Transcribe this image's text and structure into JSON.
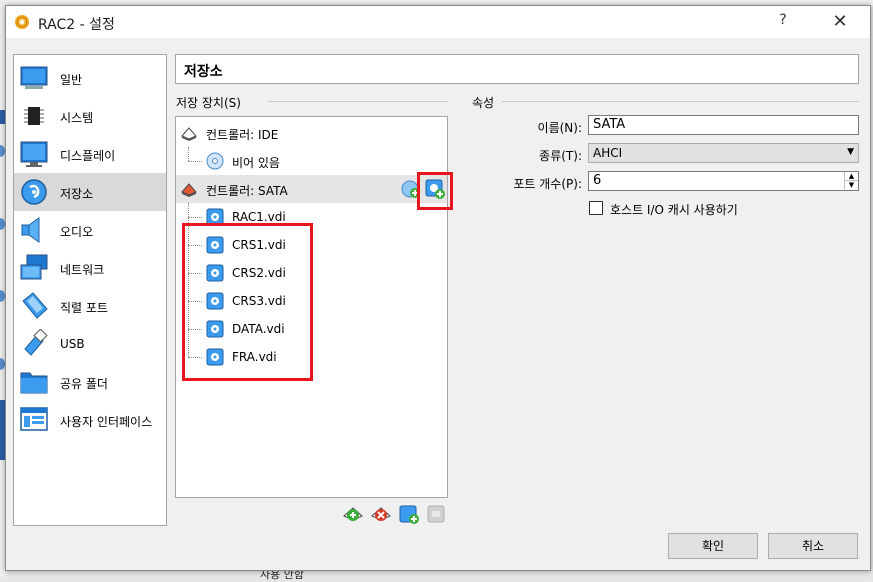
{
  "background": {
    "bottom_text": "사용 안함"
  },
  "window": {
    "title": "RAC2 - 설정",
    "help_label": "?",
    "close_label": "✕"
  },
  "nav": {
    "items": [
      {
        "label": "일반",
        "icon": "general-icon"
      },
      {
        "label": "시스템",
        "icon": "system-chip-icon"
      },
      {
        "label": "디스플레이",
        "icon": "display-icon"
      },
      {
        "label": "저장소",
        "icon": "storage-disk-icon"
      },
      {
        "label": "오디오",
        "icon": "audio-speaker-icon"
      },
      {
        "label": "네트워크",
        "icon": "network-icon"
      },
      {
        "label": "직렬 포트",
        "icon": "serial-port-icon"
      },
      {
        "label": "USB",
        "icon": "usb-icon"
      },
      {
        "label": "공유 폴더",
        "icon": "shared-folder-icon"
      },
      {
        "label": "사용자 인터페이스",
        "icon": "user-interface-icon"
      }
    ],
    "selected_index": 3
  },
  "page_title": "저장소",
  "storage": {
    "group_label": "저장 장치(S)",
    "tree": {
      "controller_ide": "컨트롤러: IDE",
      "ide_child": "비어 있음",
      "controller_sata": "컨트롤러: SATA",
      "sata_children": [
        "RAC1.vdi",
        "CRS1.vdi",
        "CRS2.vdi",
        "CRS3.vdi",
        "DATA.vdi",
        "FRA.vdi"
      ]
    }
  },
  "attributes": {
    "group_label": "속성",
    "name_label": "이름(N):",
    "name_value": "SATA",
    "type_label": "종류(T):",
    "type_value": "AHCI",
    "port_label": "포트 개수(P):",
    "port_value": "6",
    "host_cache_label": "호스트 I/O 캐시 사용하기",
    "host_cache_checked": false
  },
  "buttons": {
    "ok": "확인",
    "cancel": "취소"
  },
  "colors": {
    "highlight_red": "#e8141e",
    "accent_blue": "#1e78d2"
  }
}
